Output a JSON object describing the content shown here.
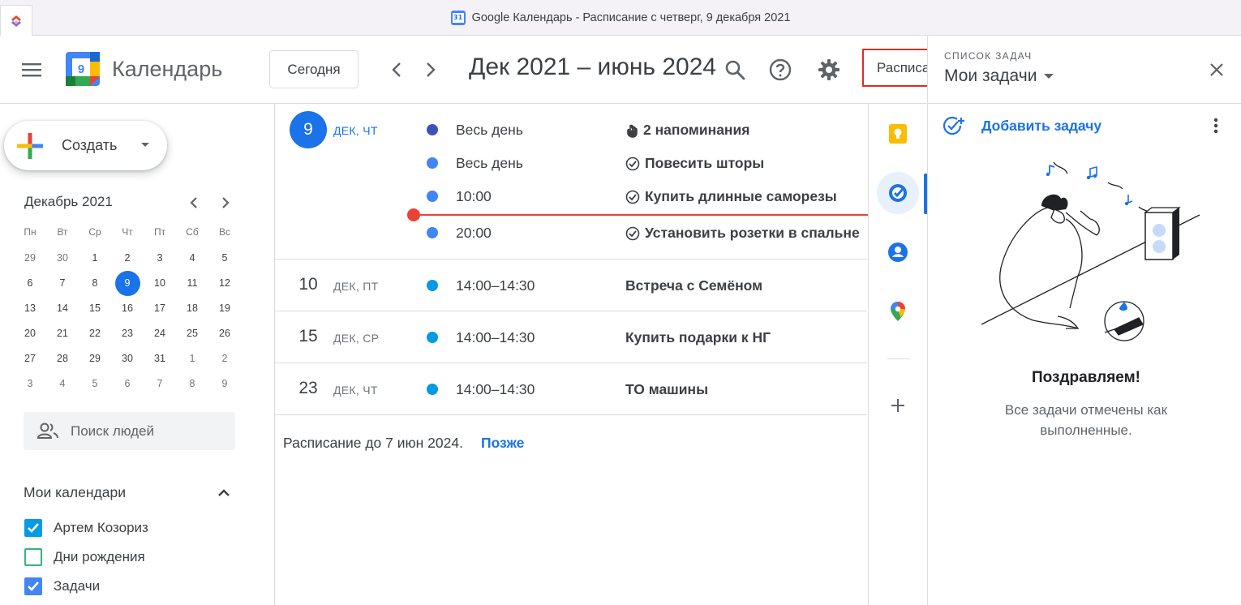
{
  "window": {
    "title": "Google Календарь - Расписание с четверг, 9 декабря 2021",
    "favicon_label": "31"
  },
  "header": {
    "logo_number": "9",
    "app_name": "Календарь",
    "today_label": "Сегодня",
    "date_range": "Дек 2021 – июнь 2024",
    "view_label": "Расписание"
  },
  "sidebar": {
    "create_label": "Создать",
    "mini_calendar": {
      "title": "Декабрь 2021",
      "weekdays": [
        "Пн",
        "Вт",
        "Ср",
        "Чт",
        "Пт",
        "Сб",
        "Вс"
      ],
      "days": [
        {
          "d": "29",
          "other": true
        },
        {
          "d": "30",
          "other": true
        },
        {
          "d": "1"
        },
        {
          "d": "2"
        },
        {
          "d": "3"
        },
        {
          "d": "4"
        },
        {
          "d": "5"
        },
        {
          "d": "6"
        },
        {
          "d": "7"
        },
        {
          "d": "8"
        },
        {
          "d": "9",
          "today": true
        },
        {
          "d": "10"
        },
        {
          "d": "11"
        },
        {
          "d": "12"
        },
        {
          "d": "13"
        },
        {
          "d": "14"
        },
        {
          "d": "15"
        },
        {
          "d": "16"
        },
        {
          "d": "17"
        },
        {
          "d": "18"
        },
        {
          "d": "19"
        },
        {
          "d": "20"
        },
        {
          "d": "21"
        },
        {
          "d": "22"
        },
        {
          "d": "23"
        },
        {
          "d": "24"
        },
        {
          "d": "25"
        },
        {
          "d": "26"
        },
        {
          "d": "27"
        },
        {
          "d": "28"
        },
        {
          "d": "29"
        },
        {
          "d": "30"
        },
        {
          "d": "31"
        },
        {
          "d": "1",
          "other": true
        },
        {
          "d": "2",
          "other": true
        },
        {
          "d": "3",
          "other": true
        },
        {
          "d": "4",
          "other": true
        },
        {
          "d": "5",
          "other": true
        },
        {
          "d": "6",
          "other": true
        },
        {
          "d": "7",
          "other": true
        },
        {
          "d": "8",
          "other": true
        },
        {
          "d": "9",
          "other": true
        }
      ]
    },
    "people_search_placeholder": "Поиск людей",
    "my_calendars_title": "Мои календари",
    "calendars": [
      {
        "name": "Артем Козориз",
        "checked": true,
        "color": "#039be5"
      },
      {
        "name": "Дни рождения",
        "checked": false,
        "color": "#33b679"
      },
      {
        "name": "Задачи",
        "checked": true,
        "color": "#4285f4"
      }
    ]
  },
  "schedule": {
    "days": [
      {
        "day": "9",
        "label": "ДЕК, ЧТ",
        "today": true,
        "events": [
          {
            "time": "Весь день",
            "title": "2 напоминания",
            "icon": "reminder-hand-icon",
            "color": "#3f51b5"
          },
          {
            "time": "Весь день",
            "title": "Повесить шторы",
            "icon": "task-check-icon",
            "color": "#4285f4"
          },
          {
            "time": "10:00",
            "title": "Купить длинные саморезы",
            "icon": "task-check-icon",
            "color": "#4285f4"
          },
          {
            "time": "20:00",
            "title": "Установить розетки в спальне",
            "icon": "task-check-icon",
            "color": "#4285f4"
          }
        ]
      },
      {
        "day": "10",
        "label": "ДЕК, ПТ",
        "events": [
          {
            "time": "14:00–14:30",
            "title": "Встреча с Семёном",
            "color": "#039be5"
          }
        ]
      },
      {
        "day": "15",
        "label": "ДЕК, СР",
        "events": [
          {
            "time": "14:00–14:30",
            "title": "Купить подарки к НГ",
            "color": "#039be5"
          }
        ]
      },
      {
        "day": "23",
        "label": "ДЕК, ЧТ",
        "events": [
          {
            "time": "14:00–14:30",
            "title": "ТО машины",
            "color": "#039be5"
          }
        ]
      }
    ],
    "footer_text": "Расписание до 7 июн 2024.",
    "footer_link": "Позже"
  },
  "side_strip": {
    "items": [
      "keep-icon",
      "tasks-icon",
      "contacts-icon",
      "maps-icon",
      "add-addon-icon"
    ],
    "active": "tasks-icon"
  },
  "tasks_panel": {
    "section_label": "СПИСОК ЗАДАЧ",
    "list_name": "Мои задачи",
    "add_task_label": "Добавить задачу",
    "congrats_title": "Поздравляем!",
    "congrats_text": "Все задачи отмечены как выполненные."
  },
  "colors": {
    "accent": "#1a73e8",
    "now_line": "#ea4335",
    "view_highlight": "#d93025"
  }
}
